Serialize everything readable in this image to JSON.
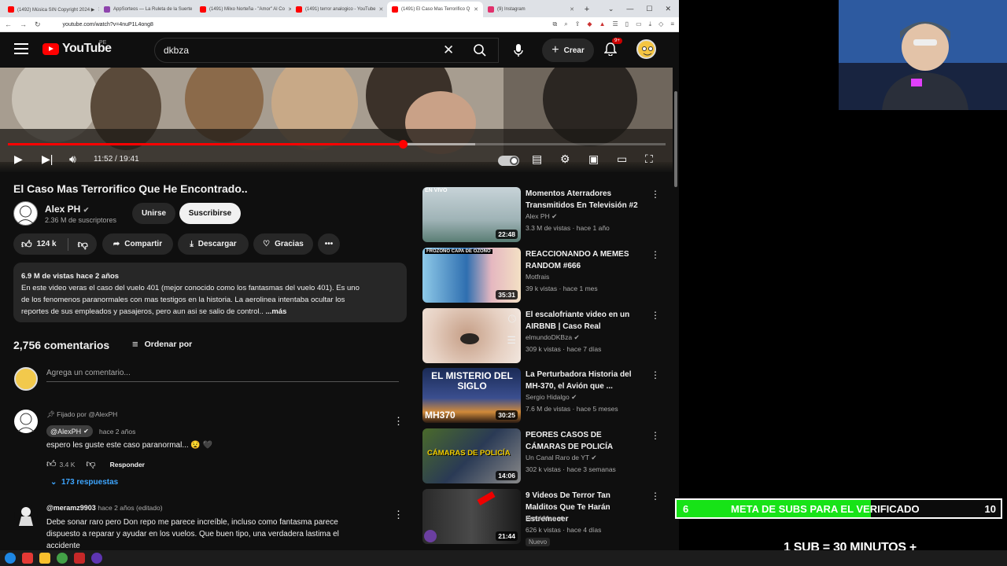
{
  "browser": {
    "tabs": [
      {
        "label": "(1492) Música SIN Copyright 2024 ▶",
        "color": "#ff0000"
      },
      {
        "label": "AppSorteos — La Ruleta de la Suerte",
        "color": "#8e44ad"
      },
      {
        "label": "(1491) Milxo Norteña - \"Amor\" Al Co",
        "color": "#ff0000"
      },
      {
        "label": "(1491) terror analogico - YouTube",
        "color": "#ff0000"
      },
      {
        "label": "(1491) El Caso Mas Terrorifico Q",
        "color": "#ff0000"
      },
      {
        "label": "(9) Instagram",
        "color": "#e1306c"
      }
    ],
    "new_tab": "+",
    "url": "youtube.com/watch?v=4nuP1L4ong8"
  },
  "header": {
    "logo_text": "YouTube",
    "region": "PE",
    "search_value": "dkbza",
    "create_label": "Crear",
    "notif_count": "9+"
  },
  "player": {
    "time": "11:52 / 19:41",
    "progress": 0.6,
    "buffered": 0.71
  },
  "video": {
    "title": "El Caso Mas Terrorifico Que He Encontrado..",
    "channel": "Alex PH",
    "subs": "2.36 M de suscriptores",
    "join": "Unirse",
    "subscribe": "Suscribirse",
    "likes": "124 k",
    "share": "Compartir",
    "download": "Descargar",
    "thanks": "Gracias",
    "views_date": "6.9 M de vistas  hace 2 años",
    "desc_line1": "En este video veras el caso del vuelo 401 (mejor conocido como los fantasmas del vuelo 401). Es uno",
    "desc_line2": "de los fenomenos paranormales con mas testigos en la historia. La aerolinea intentaba ocultar los",
    "desc_line3": "reportes de sus empleados y pasajeros, pero aun asi se salio de control..",
    "more": "...más"
  },
  "comments": {
    "count": "2,756 comentarios",
    "sort": "Ordenar por",
    "placeholder": "Agrega un comentario...",
    "pinned": "Fijado por @AlexPH",
    "c1_author": "@AlexPH",
    "c1_time": "hace 2 años",
    "c1_text": "espero les guste este caso paranormal... 😧 🖤",
    "c1_likes": "3.4 K",
    "reply": "Responder",
    "replies": "173 respuestas",
    "c2_author": "@meramz9903",
    "c2_time": "hace 2 años (editado)",
    "c2_line1": "Debe sonar raro pero Don repo me parece increíble, incluso como fantasma parece",
    "c2_line2": "dispuesto a reparar y ayudar en los vuelos. Que buen tipo, una verdadera lastima el",
    "c2_line3": "accidente"
  },
  "recs": [
    {
      "title": "Momentos Aterradores Transmitidos En Televisión #2",
      "channel": "Alex PH",
      "stats": "3.3 M de vistas · hace 1 año",
      "duration": "22:48",
      "thumb": "EN VIVO",
      "verified": true
    },
    {
      "title": "REACCIONANDO A MEMES RANDOM #666",
      "channel": "Motfrais",
      "stats": "39 k vistas · hace 1 mes",
      "duration": "35:31",
      "thumb": "FROZONO  CAPA DE OZONO",
      "verified": false
    },
    {
      "title": "El escalofriante video en un AIRBNB | Caso Real",
      "channel": "elmundoDKBza",
      "stats": "309 k vistas · hace 7 días",
      "duration": "",
      "thumb": "",
      "verified": true
    },
    {
      "title": "La Perturbadora Historia del MH-370, el Avión que ...",
      "channel": "Sergio Hidalgo",
      "stats": "7.6 M de vistas · hace 5 meses",
      "duration": "30:25",
      "thumb": "EL MISTERIO DEL SIGLO",
      "thumb2": "MH370",
      "verified": true
    },
    {
      "title": "PEORES CASOS DE CÁMARAS DE POLICÍA",
      "channel": "Un Canal Raro de YT",
      "stats": "302 k vistas · hace 3 semanas",
      "duration": "14:06",
      "thumb": "CÁMARAS DE POLICÍA",
      "verified": true
    },
    {
      "title": "9 Videos De Terror Tan Malditos Que Te Harán Estremecer",
      "channel": "BreakMan",
      "stats": "626 k vistas · hace 4 días",
      "duration": "21:44",
      "thumb": "",
      "badge": "Nuevo",
      "verified": true
    }
  ],
  "overlay": {
    "meta_start": "6",
    "meta_text": "META DE SUBS PARA EL VERIFICADO",
    "meta_goal": "10",
    "meta_progress": 0.6,
    "sub_info": "1 SUB  =  30 MINUTOS +"
  }
}
